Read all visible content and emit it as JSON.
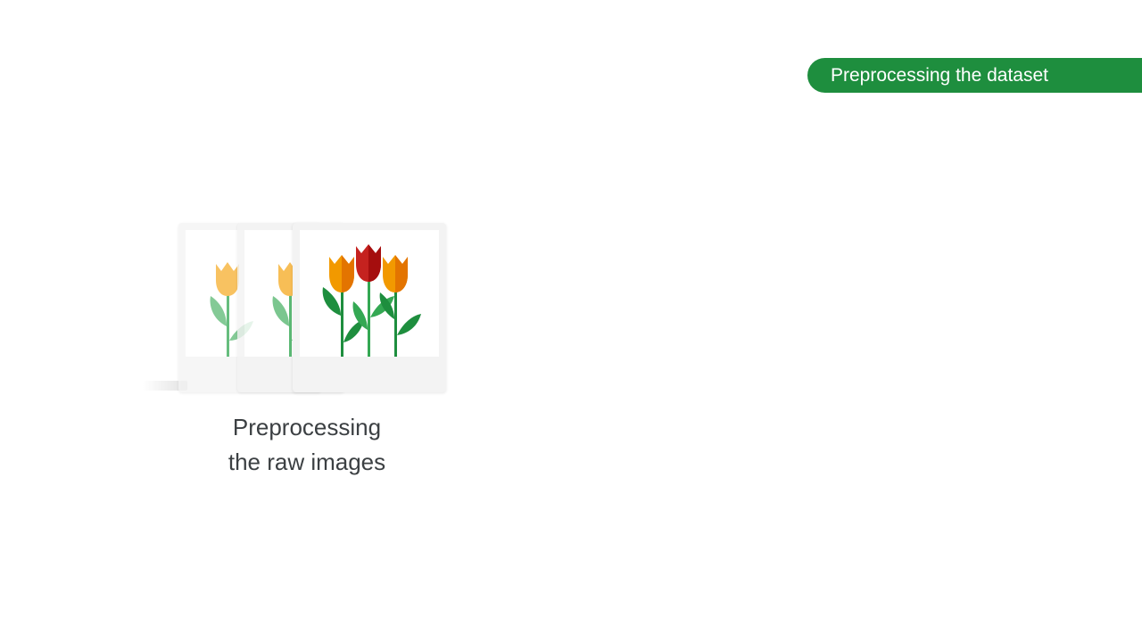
{
  "header": {
    "section_label": "Preprocessing the dataset"
  },
  "illustration": {
    "subject": "tulip-photos-stack"
  },
  "caption": {
    "line1": "Preprocessing",
    "line2": "the raw images"
  },
  "colors": {
    "pill_green": "#1e8e3e",
    "tulip_orange": "#f29900",
    "tulip_red": "#c5221f",
    "leaf_green": "#1e8e3e",
    "text_gray": "#3c4043"
  }
}
